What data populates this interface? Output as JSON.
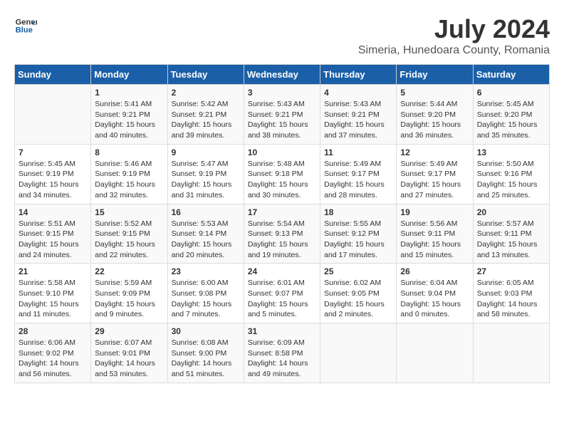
{
  "header": {
    "logo_line1": "General",
    "logo_line2": "Blue",
    "title": "July 2024",
    "subtitle": "Simeria, Hunedoara County, Romania"
  },
  "weekdays": [
    "Sunday",
    "Monday",
    "Tuesday",
    "Wednesday",
    "Thursday",
    "Friday",
    "Saturday"
  ],
  "weeks": [
    [
      {
        "day": "",
        "info": ""
      },
      {
        "day": "1",
        "info": "Sunrise: 5:41 AM\nSunset: 9:21 PM\nDaylight: 15 hours\nand 40 minutes."
      },
      {
        "day": "2",
        "info": "Sunrise: 5:42 AM\nSunset: 9:21 PM\nDaylight: 15 hours\nand 39 minutes."
      },
      {
        "day": "3",
        "info": "Sunrise: 5:43 AM\nSunset: 9:21 PM\nDaylight: 15 hours\nand 38 minutes."
      },
      {
        "day": "4",
        "info": "Sunrise: 5:43 AM\nSunset: 9:21 PM\nDaylight: 15 hours\nand 37 minutes."
      },
      {
        "day": "5",
        "info": "Sunrise: 5:44 AM\nSunset: 9:20 PM\nDaylight: 15 hours\nand 36 minutes."
      },
      {
        "day": "6",
        "info": "Sunrise: 5:45 AM\nSunset: 9:20 PM\nDaylight: 15 hours\nand 35 minutes."
      }
    ],
    [
      {
        "day": "7",
        "info": "Sunrise: 5:45 AM\nSunset: 9:19 PM\nDaylight: 15 hours\nand 34 minutes."
      },
      {
        "day": "8",
        "info": "Sunrise: 5:46 AM\nSunset: 9:19 PM\nDaylight: 15 hours\nand 32 minutes."
      },
      {
        "day": "9",
        "info": "Sunrise: 5:47 AM\nSunset: 9:19 PM\nDaylight: 15 hours\nand 31 minutes."
      },
      {
        "day": "10",
        "info": "Sunrise: 5:48 AM\nSunset: 9:18 PM\nDaylight: 15 hours\nand 30 minutes."
      },
      {
        "day": "11",
        "info": "Sunrise: 5:49 AM\nSunset: 9:17 PM\nDaylight: 15 hours\nand 28 minutes."
      },
      {
        "day": "12",
        "info": "Sunrise: 5:49 AM\nSunset: 9:17 PM\nDaylight: 15 hours\nand 27 minutes."
      },
      {
        "day": "13",
        "info": "Sunrise: 5:50 AM\nSunset: 9:16 PM\nDaylight: 15 hours\nand 25 minutes."
      }
    ],
    [
      {
        "day": "14",
        "info": "Sunrise: 5:51 AM\nSunset: 9:15 PM\nDaylight: 15 hours\nand 24 minutes."
      },
      {
        "day": "15",
        "info": "Sunrise: 5:52 AM\nSunset: 9:15 PM\nDaylight: 15 hours\nand 22 minutes."
      },
      {
        "day": "16",
        "info": "Sunrise: 5:53 AM\nSunset: 9:14 PM\nDaylight: 15 hours\nand 20 minutes."
      },
      {
        "day": "17",
        "info": "Sunrise: 5:54 AM\nSunset: 9:13 PM\nDaylight: 15 hours\nand 19 minutes."
      },
      {
        "day": "18",
        "info": "Sunrise: 5:55 AM\nSunset: 9:12 PM\nDaylight: 15 hours\nand 17 minutes."
      },
      {
        "day": "19",
        "info": "Sunrise: 5:56 AM\nSunset: 9:11 PM\nDaylight: 15 hours\nand 15 minutes."
      },
      {
        "day": "20",
        "info": "Sunrise: 5:57 AM\nSunset: 9:11 PM\nDaylight: 15 hours\nand 13 minutes."
      }
    ],
    [
      {
        "day": "21",
        "info": "Sunrise: 5:58 AM\nSunset: 9:10 PM\nDaylight: 15 hours\nand 11 minutes."
      },
      {
        "day": "22",
        "info": "Sunrise: 5:59 AM\nSunset: 9:09 PM\nDaylight: 15 hours\nand 9 minutes."
      },
      {
        "day": "23",
        "info": "Sunrise: 6:00 AM\nSunset: 9:08 PM\nDaylight: 15 hours\nand 7 minutes."
      },
      {
        "day": "24",
        "info": "Sunrise: 6:01 AM\nSunset: 9:07 PM\nDaylight: 15 hours\nand 5 minutes."
      },
      {
        "day": "25",
        "info": "Sunrise: 6:02 AM\nSunset: 9:05 PM\nDaylight: 15 hours\nand 2 minutes."
      },
      {
        "day": "26",
        "info": "Sunrise: 6:04 AM\nSunset: 9:04 PM\nDaylight: 15 hours\nand 0 minutes."
      },
      {
        "day": "27",
        "info": "Sunrise: 6:05 AM\nSunset: 9:03 PM\nDaylight: 14 hours\nand 58 minutes."
      }
    ],
    [
      {
        "day": "28",
        "info": "Sunrise: 6:06 AM\nSunset: 9:02 PM\nDaylight: 14 hours\nand 56 minutes."
      },
      {
        "day": "29",
        "info": "Sunrise: 6:07 AM\nSunset: 9:01 PM\nDaylight: 14 hours\nand 53 minutes."
      },
      {
        "day": "30",
        "info": "Sunrise: 6:08 AM\nSunset: 9:00 PM\nDaylight: 14 hours\nand 51 minutes."
      },
      {
        "day": "31",
        "info": "Sunrise: 6:09 AM\nSunset: 8:58 PM\nDaylight: 14 hours\nand 49 minutes."
      },
      {
        "day": "",
        "info": ""
      },
      {
        "day": "",
        "info": ""
      },
      {
        "day": "",
        "info": ""
      }
    ]
  ]
}
